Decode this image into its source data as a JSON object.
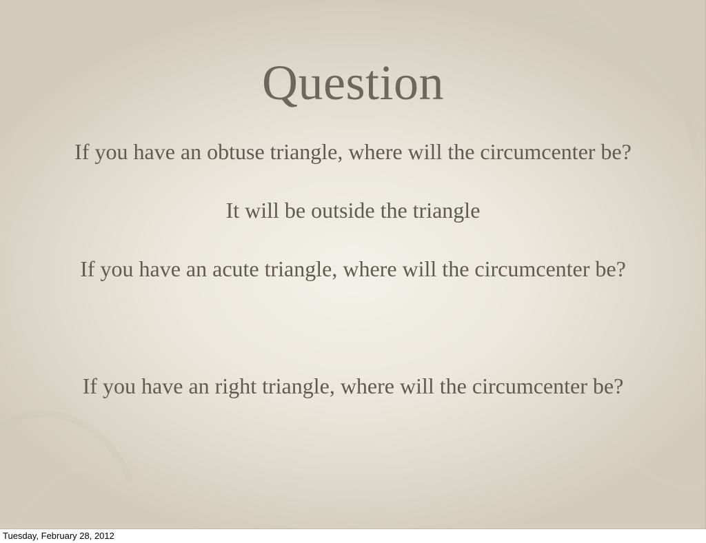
{
  "slide": {
    "title": "Question",
    "lines": [
      "If you have an obtuse triangle, where will the circumcenter be?",
      "It will be outside the triangle",
      "If you have an acute triangle, where will the circumcenter be?",
      "If you have an right triangle, where will the circumcenter be?"
    ]
  },
  "footer": {
    "date": "Tuesday, February 28, 2012"
  }
}
